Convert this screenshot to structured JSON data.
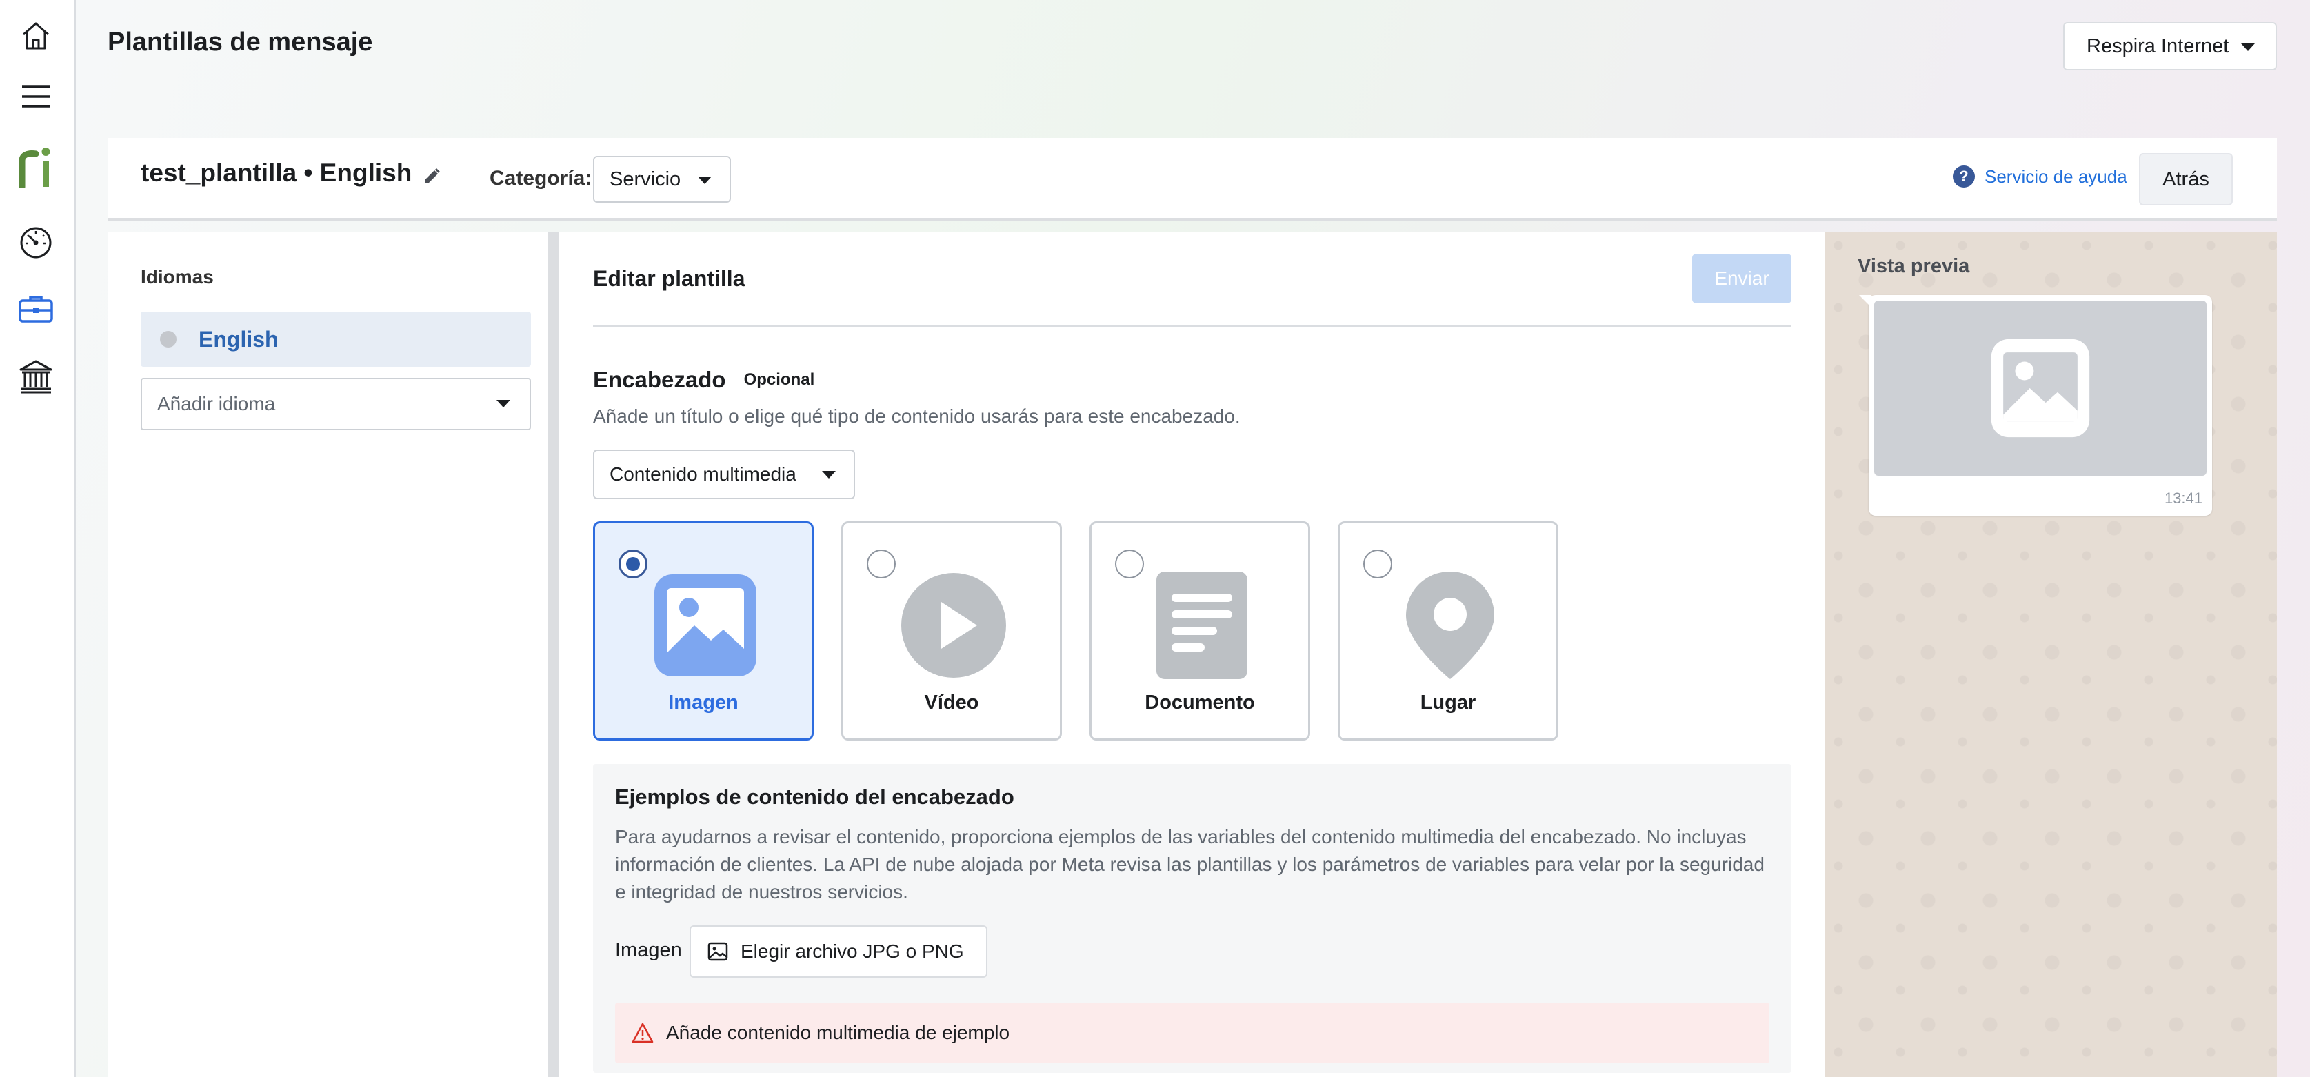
{
  "header": {
    "title": "Plantillas de mensaje",
    "account": "Respira Internet"
  },
  "rail": {
    "icons": [
      "home-icon",
      "menu-icon",
      "ri-logo",
      "dashboard-icon",
      "briefcase-icon",
      "bank-icon"
    ],
    "active": "briefcase-icon"
  },
  "template_bar": {
    "name": "test_plantilla • English",
    "category_label": "Categoría:",
    "category_value": "Servicio",
    "help_label": "Servicio de ayuda",
    "back_label": "Atrás"
  },
  "languages": {
    "title": "Idiomas",
    "items": [
      {
        "label": "English",
        "selected": true
      }
    ],
    "add_placeholder": "Añadir idioma"
  },
  "editor": {
    "title": "Editar plantilla",
    "send_label": "Enviar",
    "header_section": {
      "title": "Encabezado",
      "badge": "Opcional",
      "subtitle": "Añade un título o elige qué tipo de contenido usarás para este encabezado.",
      "type_select": "Contenido multimedia"
    },
    "media_options": [
      {
        "label": "Imagen",
        "selected": true
      },
      {
        "label": "Vídeo",
        "selected": false
      },
      {
        "label": "Documento",
        "selected": false
      },
      {
        "label": "Lugar",
        "selected": false
      }
    ],
    "examples": {
      "title": "Ejemplos de contenido del encabezado",
      "body": "Para ayudarnos a revisar el contenido, proporciona ejemplos de las variables del contenido multimedia del encabezado. No incluyas información de clientes. La API de nube alojada por Meta revisa las plantillas y los parámetros de variables para velar por la seguridad e integridad de nuestros servicios.",
      "image_label": "Imagen",
      "choose_label": "Elegir archivo JPG o PNG",
      "alert": "Añade contenido multimedia de ejemplo"
    }
  },
  "preview": {
    "title": "Vista previa",
    "time": "13:41"
  },
  "colors": {
    "accent": "#2d6cdf",
    "send_disabled": "#c3d8f5",
    "alert_bg": "#fcebeb",
    "alert_icon": "#d93025"
  }
}
